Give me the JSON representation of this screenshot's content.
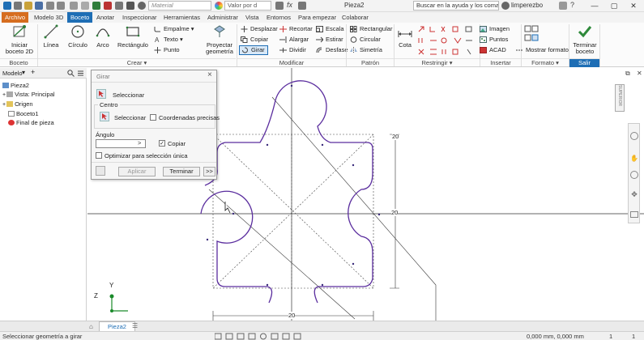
{
  "titlebar": {
    "material_placeholder": "Material",
    "appearance_value": "Valor por d",
    "fx": "fx",
    "title": "Pieza2",
    "search_placeholder": "Buscar en la ayuda y los comand",
    "user": "limperezbo",
    "help": "?",
    "minimize": "—",
    "maximize": "▢",
    "close": "✕"
  },
  "tabs": [
    {
      "label": "Archivo"
    },
    {
      "label": "Modelo 3D"
    },
    {
      "label": "Boceto"
    },
    {
      "label": "Anotar"
    },
    {
      "label": "Inspeccionar"
    },
    {
      "label": "Herramientas"
    },
    {
      "label": "Administrar"
    },
    {
      "label": "Vista"
    },
    {
      "label": "Entornos"
    },
    {
      "label": "Para empezar"
    },
    {
      "label": "Colaborar"
    }
  ],
  "ribbon": {
    "boceto": {
      "title": "Boceto",
      "start_line1": "Iniciar",
      "start_line2": "boceto 2D"
    },
    "crear": {
      "title": "Crear",
      "linea": "Línea",
      "circulo": "Círculo",
      "arco": "Arco",
      "rectangulo": "Rectángulo",
      "empalme": "Empalme",
      "texto": "Texto",
      "punto": "Punto",
      "proyectar_line1": "Proyectar",
      "proyectar_line2": "geometría"
    },
    "modificar": {
      "title": "Modificar",
      "desplazar": "Desplazar",
      "copiar": "Copiar",
      "girar": "Girar",
      "recortar": "Recortar",
      "alargar": "Alargar",
      "dividir": "Dividir",
      "escala": "Escala",
      "estirar": "Estirar",
      "desfase": "Desfase"
    },
    "patron": {
      "title": "Patrón",
      "rectangular": "Rectangular",
      "circular": "Circular",
      "simetria": "Simetría"
    },
    "restringir": {
      "title": "Restringir",
      "cota": "Cota"
    },
    "insertar": {
      "title": "Insertar",
      "imagen": "Imagen",
      "puntos": "Puntos",
      "acad": "ACAD"
    },
    "formato": {
      "title": "Formato",
      "mostrar": "Mostrar formato"
    },
    "salir": {
      "title": "Salir",
      "terminar_line1": "Terminar",
      "terminar_line2": "boceto"
    }
  },
  "browser": {
    "tab_label": "Modelo",
    "add": "+",
    "items": [
      {
        "label": "Pieza2"
      },
      {
        "label": "Vista: Principal"
      },
      {
        "label": "Origen"
      },
      {
        "label": "Boceto1"
      },
      {
        "label": "Final de pieza"
      }
    ]
  },
  "dialog": {
    "title": "Girar",
    "close": "×",
    "select_label": "Seleccionar",
    "center_group": "Centro",
    "center_select": "Seleccionar",
    "precise_label": "Coordenadas precisas",
    "angle_label": "Ángulo",
    "angle_value": "",
    "angle_arrow": ">",
    "copy_label": "Copiar",
    "copy_checked": true,
    "optimize_label": "Optimizar para selección única",
    "apply": "Aplicar",
    "finish": "Terminar",
    "more": ">>"
  },
  "canvas": {
    "dim_top": "20",
    "dim_right": "20",
    "dim_bottom": "20",
    "viewcube": "SUPERIOR",
    "axis_y": "Y",
    "axis_z": "Z"
  },
  "doctabs": {
    "tab": "Pieza2"
  },
  "status": {
    "message": "Seleccionar geometría a girar",
    "coords": "0,000 mm, 0,000 mm",
    "page1": "1",
    "page2": "1"
  },
  "colors": {
    "sketch": "#5a2d9e",
    "file_tab": "#d66d1f",
    "active_tab": "#1e6eb5"
  }
}
